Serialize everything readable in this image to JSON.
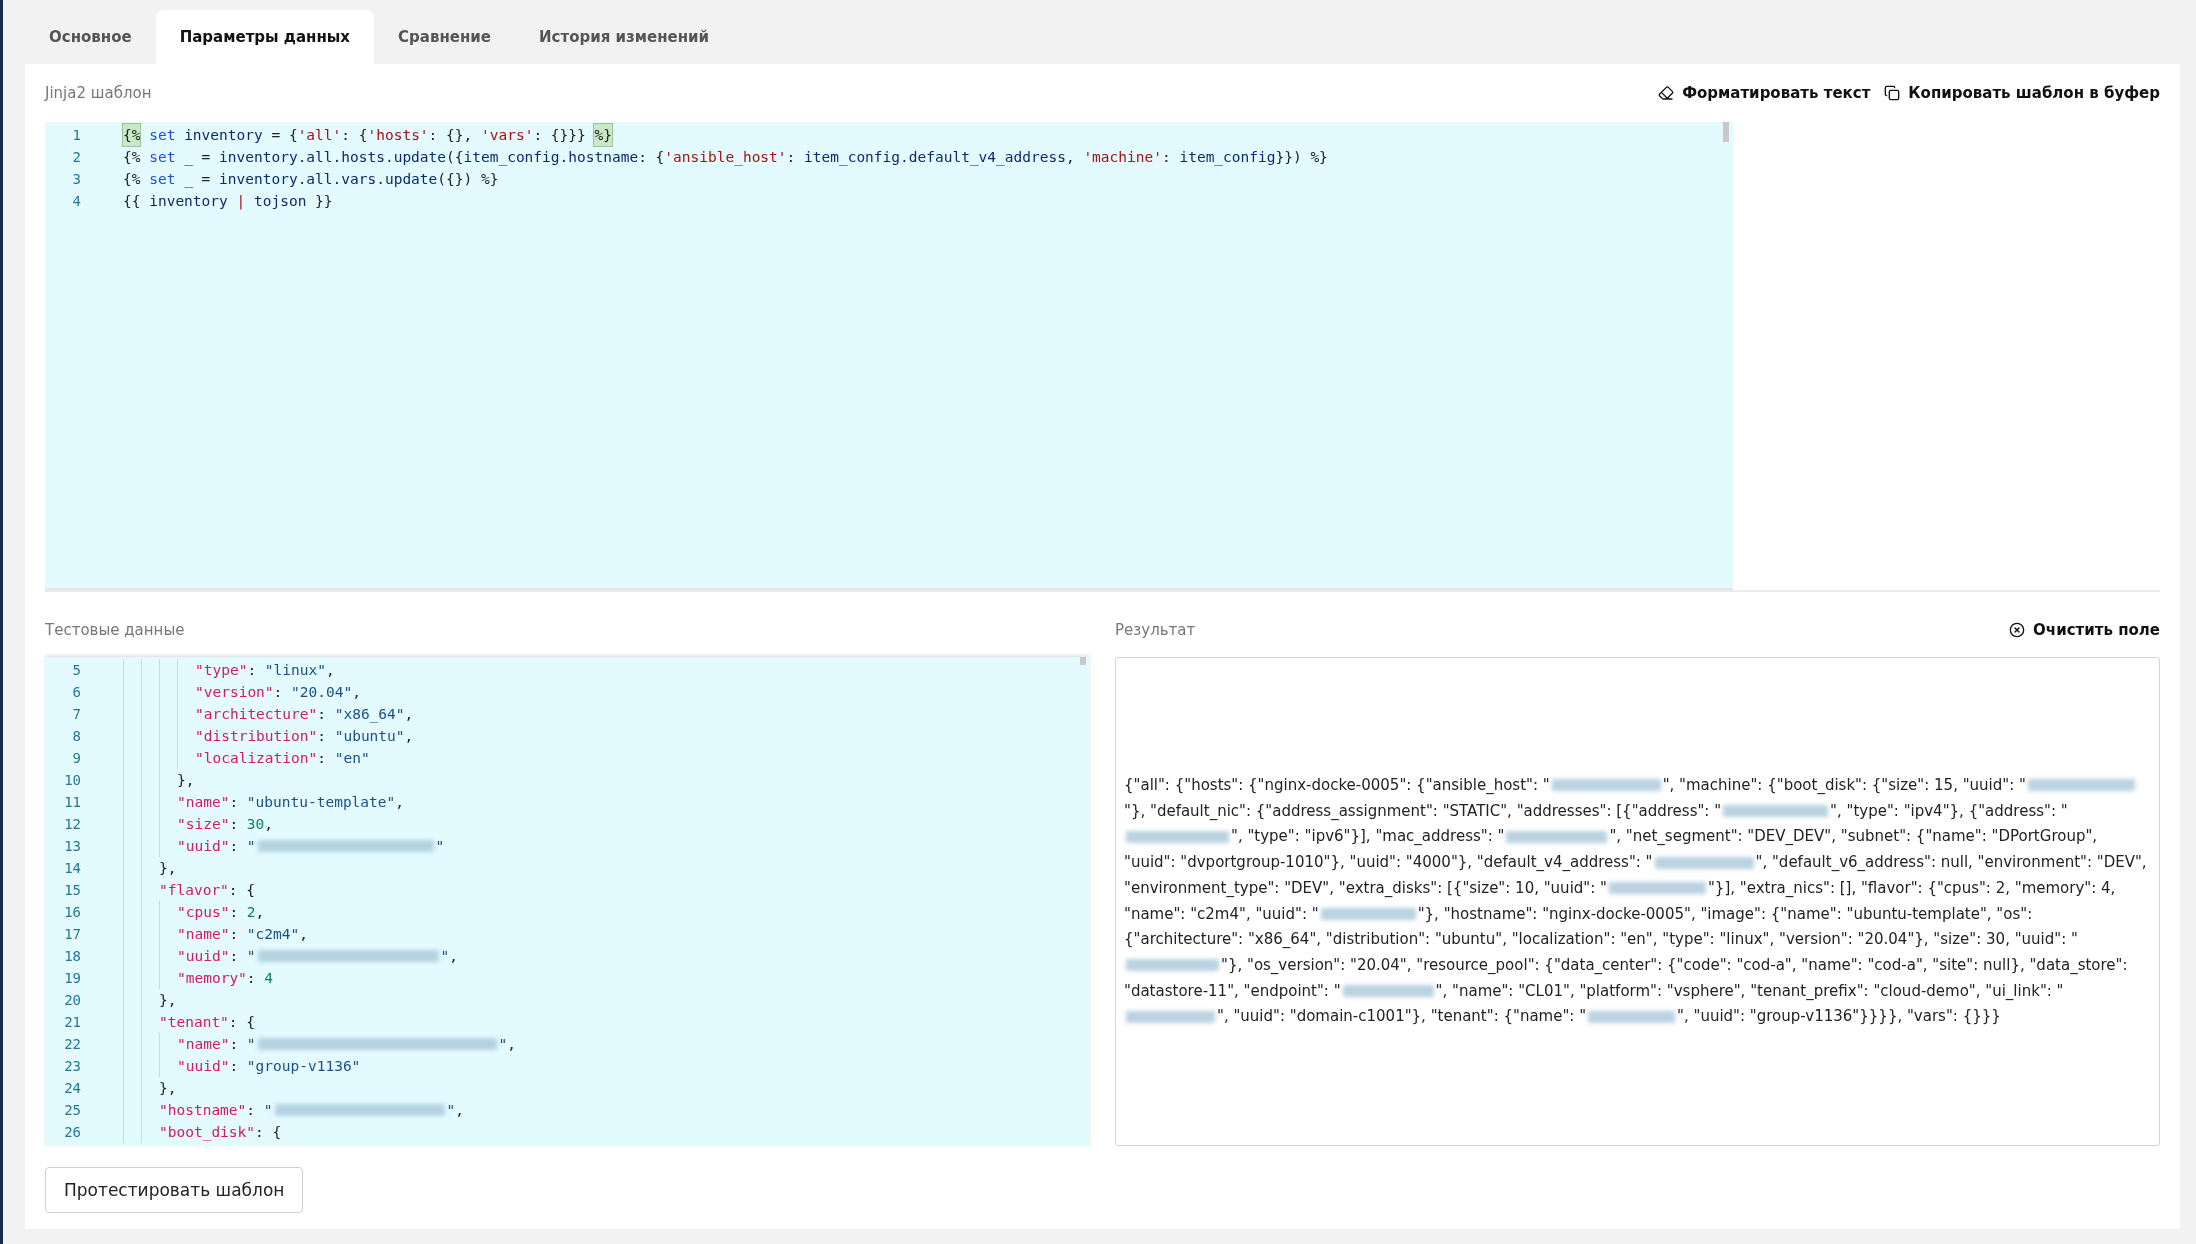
{
  "tabs": [
    {
      "label": "Основное",
      "selected": false
    },
    {
      "label": "Параметры данных",
      "selected": true
    },
    {
      "label": "Сравнение",
      "selected": false
    },
    {
      "label": "История изменений",
      "selected": false
    }
  ],
  "template": {
    "label": "Jinja2 шаблон",
    "actions": [
      {
        "kind": "format",
        "label": "Форматировать текст"
      },
      {
        "kind": "copy",
        "label": "Копировать шаблон в буфер"
      }
    ],
    "lines": [
      {
        "number": "1",
        "tokens": [
          {
            "kind": "match",
            "text": "{%"
          },
          {
            "kind": "kw",
            "text": " set "
          },
          {
            "kind": "id",
            "text": "inventory"
          },
          {
            "kind": "p",
            "text": " = {"
          },
          {
            "kind": "q",
            "text": "'all'"
          },
          {
            "kind": "p",
            "text": ": {"
          },
          {
            "kind": "q",
            "text": "'hosts'"
          },
          {
            "kind": "p",
            "text": ": {}, "
          },
          {
            "kind": "q",
            "text": "'vars'"
          },
          {
            "kind": "p",
            "text": ": {}}} "
          },
          {
            "kind": "match",
            "text": "%}"
          }
        ]
      },
      {
        "number": "2",
        "tokens": [
          {
            "kind": "p",
            "text": "{% "
          },
          {
            "kind": "kw",
            "text": "set"
          },
          {
            "kind": "p",
            "text": " _ = "
          },
          {
            "kind": "id",
            "text": "inventory.all.hosts.update"
          },
          {
            "kind": "p",
            "text": "({"
          },
          {
            "kind": "id",
            "text": "item_config.hostname"
          },
          {
            "kind": "p",
            "text": ": {"
          },
          {
            "kind": "q",
            "text": "'ansible_host'"
          },
          {
            "kind": "p",
            "text": ": "
          },
          {
            "kind": "id",
            "text": "item_config.default_v4_address"
          },
          {
            "kind": "p",
            "text": ", "
          },
          {
            "kind": "q",
            "text": "'machine'"
          },
          {
            "kind": "p",
            "text": ": "
          },
          {
            "kind": "id",
            "text": "item_config"
          },
          {
            "kind": "p",
            "text": "}}) %}"
          }
        ]
      },
      {
        "number": "3",
        "tokens": [
          {
            "kind": "p",
            "text": "{% "
          },
          {
            "kind": "kw",
            "text": "set"
          },
          {
            "kind": "p",
            "text": " _ = "
          },
          {
            "kind": "id",
            "text": "inventory.all.vars.update"
          },
          {
            "kind": "p",
            "text": "({}) %}"
          }
        ]
      },
      {
        "number": "4",
        "tokens": [
          {
            "kind": "p",
            "text": "{{ "
          },
          {
            "kind": "id",
            "text": "inventory "
          },
          {
            "kind": "q",
            "text": "|"
          },
          {
            "kind": "id",
            "text": " tojson"
          },
          {
            "kind": "p",
            "text": " }}"
          }
        ]
      }
    ]
  },
  "test_data": {
    "label": "Тестовые данные",
    "lines": [
      {
        "number": "5",
        "tokens": [
          {
            "kind": "key",
            "text": "        \"type\""
          },
          {
            "kind": "p",
            "text": ": "
          },
          {
            "kind": "str",
            "text": "\"linux\""
          },
          {
            "kind": "p",
            "text": ","
          }
        ]
      },
      {
        "number": "6",
        "tokens": [
          {
            "kind": "key",
            "text": "        \"version\""
          },
          {
            "kind": "p",
            "text": ": "
          },
          {
            "kind": "str",
            "text": "\"20.04\""
          },
          {
            "kind": "p",
            "text": ","
          }
        ]
      },
      {
        "number": "7",
        "tokens": [
          {
            "kind": "key",
            "text": "        \"architecture\""
          },
          {
            "kind": "p",
            "text": ": "
          },
          {
            "kind": "str",
            "text": "\"x86_64\""
          },
          {
            "kind": "p",
            "text": ","
          }
        ]
      },
      {
        "number": "8",
        "tokens": [
          {
            "kind": "key",
            "text": "        \"distribution\""
          },
          {
            "kind": "p",
            "text": ": "
          },
          {
            "kind": "str",
            "text": "\"ubuntu\""
          },
          {
            "kind": "p",
            "text": ","
          }
        ]
      },
      {
        "number": "9",
        "tokens": [
          {
            "kind": "key",
            "text": "        \"localization\""
          },
          {
            "kind": "p",
            "text": ": "
          },
          {
            "kind": "str",
            "text": "\"en\""
          }
        ]
      },
      {
        "number": "10",
        "tokens": [
          {
            "kind": "p",
            "text": "      },"
          }
        ]
      },
      {
        "number": "11",
        "tokens": [
          {
            "kind": "key",
            "text": "      \"name\""
          },
          {
            "kind": "p",
            "text": ": "
          },
          {
            "kind": "str",
            "text": "\"ubuntu-template\""
          },
          {
            "kind": "p",
            "text": ","
          }
        ]
      },
      {
        "number": "12",
        "tokens": [
          {
            "kind": "key",
            "text": "      \"size\""
          },
          {
            "kind": "p",
            "text": ": "
          },
          {
            "kind": "num",
            "text": "30"
          },
          {
            "kind": "p",
            "text": ","
          }
        ]
      },
      {
        "number": "13",
        "tokens": [
          {
            "kind": "key",
            "text": "      \"uuid\""
          },
          {
            "kind": "p",
            "text": ": "
          },
          {
            "kind": "str",
            "text": "\""
          },
          {
            "kind": "redacted"
          },
          {
            "kind": "str",
            "text": "\""
          }
        ]
      },
      {
        "number": "14",
        "tokens": [
          {
            "kind": "p",
            "text": "    },"
          }
        ]
      },
      {
        "number": "15",
        "tokens": [
          {
            "kind": "key",
            "text": "    \"flavor\""
          },
          {
            "kind": "p",
            "text": ": {"
          }
        ]
      },
      {
        "number": "16",
        "tokens": [
          {
            "kind": "key",
            "text": "      \"cpus\""
          },
          {
            "kind": "p",
            "text": ": "
          },
          {
            "kind": "num",
            "text": "2"
          },
          {
            "kind": "p",
            "text": ","
          }
        ]
      },
      {
        "number": "17",
        "tokens": [
          {
            "kind": "key",
            "text": "      \"name\""
          },
          {
            "kind": "p",
            "text": ": "
          },
          {
            "kind": "str",
            "text": "\"c2m4\""
          },
          {
            "kind": "p",
            "text": ","
          }
        ]
      },
      {
        "number": "18",
        "tokens": [
          {
            "kind": "key",
            "text": "      \"uuid\""
          },
          {
            "kind": "p",
            "text": ": "
          },
          {
            "kind": "str",
            "text": "\""
          },
          {
            "kind": "redacted"
          },
          {
            "kind": "str",
            "text": "\""
          },
          {
            "kind": "p",
            "text": ","
          }
        ]
      },
      {
        "number": "19",
        "tokens": [
          {
            "kind": "key",
            "text": "      \"memory\""
          },
          {
            "kind": "p",
            "text": ": "
          },
          {
            "kind": "num",
            "text": "4"
          }
        ]
      },
      {
        "number": "20",
        "tokens": [
          {
            "kind": "p",
            "text": "    },"
          }
        ]
      },
      {
        "number": "21",
        "tokens": [
          {
            "kind": "key",
            "text": "    \"tenant\""
          },
          {
            "kind": "p",
            "text": ": {"
          }
        ]
      },
      {
        "number": "22",
        "tokens": [
          {
            "kind": "key",
            "text": "      \"name\""
          },
          {
            "kind": "p",
            "text": ": "
          },
          {
            "kind": "str",
            "text": "\""
          },
          {
            "kind": "redacted"
          },
          {
            "kind": "str",
            "text": "\""
          },
          {
            "kind": "p",
            "text": ","
          }
        ]
      },
      {
        "number": "23",
        "tokens": [
          {
            "kind": "key",
            "text": "      \"uuid\""
          },
          {
            "kind": "p",
            "text": ": "
          },
          {
            "kind": "str",
            "text": "\"group-v1136\""
          }
        ]
      },
      {
        "number": "24",
        "tokens": [
          {
            "kind": "p",
            "text": "    },"
          }
        ]
      },
      {
        "number": "25",
        "tokens": [
          {
            "kind": "key",
            "text": "    \"hostname\""
          },
          {
            "kind": "p",
            "text": ": "
          },
          {
            "kind": "str",
            "text": "\""
          },
          {
            "kind": "redacted"
          },
          {
            "kind": "str",
            "text": "\""
          },
          {
            "kind": "p",
            "text": ","
          }
        ]
      },
      {
        "number": "26",
        "tokens": [
          {
            "kind": "key",
            "text": "    \"boot_disk\""
          },
          {
            "kind": "p",
            "text": ": {"
          }
        ]
      }
    ]
  },
  "result": {
    "label": "Результат",
    "clear_label": "Очистить поле",
    "segments": [
      {
        "kind": "text",
        "text": "{\"all\": {\"hosts\": {\"nginx-docke-0005\": {\"ansible_host\": \""
      },
      {
        "kind": "redacted"
      },
      {
        "kind": "text",
        "text": "\", \"machine\": {\"boot_disk\": {\"size\": 15, \"uuid\": \""
      },
      {
        "kind": "redacted"
      },
      {
        "kind": "text",
        "text": "\"}, \"default_nic\": {\"address_assignment\": \"STATIC\", \"addresses\": [{\"address\": \""
      },
      {
        "kind": "redacted"
      },
      {
        "kind": "text",
        "text": "\", \"type\": \"ipv4\"}, {\"address\": \""
      },
      {
        "kind": "redacted"
      },
      {
        "kind": "text",
        "text": "\", \"type\": \"ipv6\"}], \"mac_address\": \""
      },
      {
        "kind": "redacted"
      },
      {
        "kind": "text",
        "text": "\", \"net_segment\": \"DEV_DEV\", \"subnet\": {\"name\": \"DPortGroup\", \"uuid\": \"dvportgroup-1010\"}, \"uuid\": \"4000\"}, \"default_v4_address\": \""
      },
      {
        "kind": "redacted"
      },
      {
        "kind": "text",
        "text": "\", \"default_v6_address\": null, \"environment\": \"DEV\", \"environment_type\": \"DEV\", \"extra_disks\": [{\"size\": 10, \"uuid\": \""
      },
      {
        "kind": "redacted"
      },
      {
        "kind": "text",
        "text": "\"}], \"extra_nics\": [], \"flavor\": {\"cpus\": 2, \"memory\": 4, \"name\": \"c2m4\", \"uuid\": \""
      },
      {
        "kind": "redacted"
      },
      {
        "kind": "text",
        "text": "\"}, \"hostname\": \"nginx-docke-0005\", \"image\": {\"name\": \"ubuntu-template\", \"os\": {\"architecture\": \"x86_64\", \"distribution\": \"ubuntu\", \"localization\": \"en\", \"type\": \"linux\", \"version\": \"20.04\"}, \"size\": 30, \"uuid\": \""
      },
      {
        "kind": "redacted"
      },
      {
        "kind": "text",
        "text": "\"}, \"os_version\": \"20.04\", \"resource_pool\": {\"data_center\": {\"code\": \"cod-a\", \"name\": \"cod-a\", \"site\": null}, \"data_store\": \"datastore-11\", \"endpoint\": \""
      },
      {
        "kind": "redacted"
      },
      {
        "kind": "text",
        "text": "\", \"name\": \"CL01\", \"platform\": \"vsphere\", \"tenant_prefix\": \"cloud-demo\", \"ui_link\": \""
      },
      {
        "kind": "redacted"
      },
      {
        "kind": "text",
        "text": "\", \"uuid\": \"domain-c1001\"}, \"tenant\": {\"name\": \""
      },
      {
        "kind": "redacted"
      },
      {
        "kind": "text",
        "text": "\", \"uuid\": \"group-v1136\"}}}}, \"vars\": {}}}"
      }
    ]
  },
  "test_button": {
    "label": "Протестировать шаблон"
  }
}
